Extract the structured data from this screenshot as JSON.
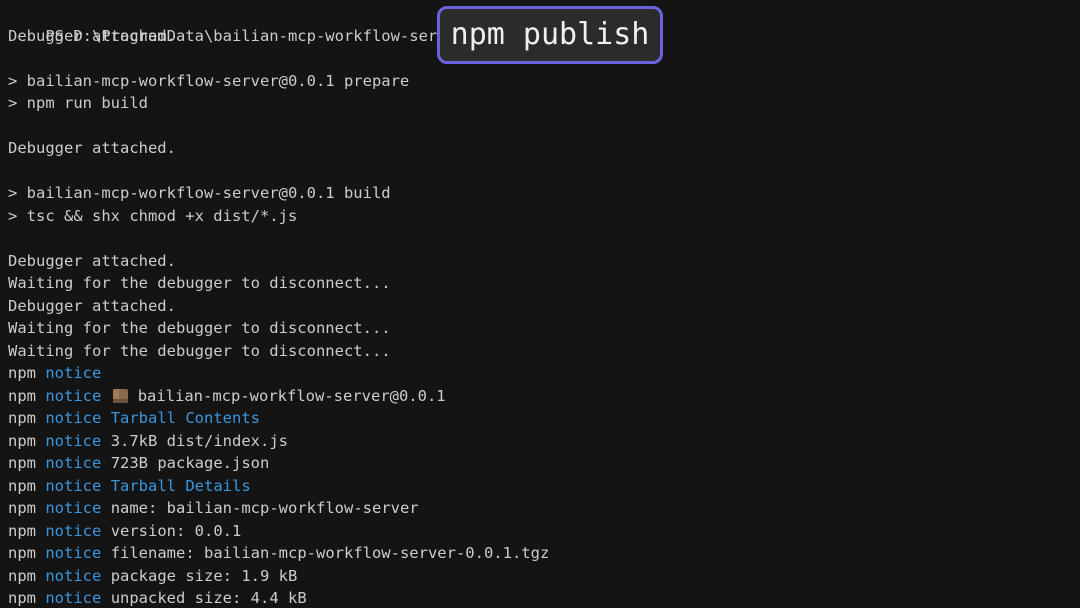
{
  "prompt_line": "PS D:\\ProgramData\\bailian-mcp-workflow-server>",
  "callout_command": "npm publish",
  "lines": [
    "Debugger attached.",
    "",
    "> bailian-mcp-workflow-server@0.0.1 prepare",
    "> npm run build",
    "",
    "Debugger attached.",
    "",
    "> bailian-mcp-workflow-server@0.0.1 build",
    "> tsc && shx chmod +x dist/*.js",
    "",
    "Debugger attached.",
    "Waiting for the debugger to disconnect...",
    "Debugger attached.",
    "Waiting for the debugger to disconnect...",
    "Waiting for the debugger to disconnect..."
  ],
  "npm_prefix": "npm",
  "notice_word": "notice",
  "npm_lines": [
    {
      "text": "",
      "blue": false
    },
    {
      "text": "bailian-mcp-workflow-server@0.0.1",
      "blue": false,
      "icon": "package-icon"
    },
    {
      "text": "Tarball Contents",
      "blue": true
    },
    {
      "text": "3.7kB dist/index.js",
      "blue": false
    },
    {
      "text": "723B package.json",
      "blue": false
    },
    {
      "text": "Tarball Details",
      "blue": true
    },
    {
      "text": "name: bailian-mcp-workflow-server",
      "blue": false
    },
    {
      "text": "version: 0.0.1",
      "blue": false
    },
    {
      "text": "filename: bailian-mcp-workflow-server-0.0.1.tgz",
      "blue": false
    },
    {
      "text": "package size: 1.9 kB",
      "blue": false
    },
    {
      "text": "unpacked size: 4.4 kB",
      "blue": false
    }
  ],
  "colors": {
    "background": "#141414",
    "text": "#cccccc",
    "notice_blue": "#3a96dd",
    "callout_border": "#6a63e0",
    "callout_bg": "#2b2b2b"
  }
}
